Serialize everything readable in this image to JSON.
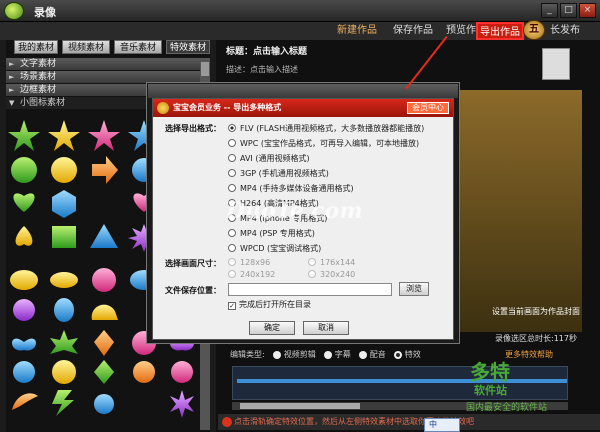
{
  "window": {
    "title": "录像"
  },
  "toolbar": {
    "new": "新建作品",
    "save": "保存作品",
    "preview": "预览作品",
    "export": "导出作品",
    "publish": "长发布",
    "publish_icon_text": "五"
  },
  "left": {
    "tabs": [
      "我的素材",
      "视频素材",
      "音乐素材",
      "特效素材"
    ],
    "active_tab": 3,
    "categories": [
      "文字素材",
      "场景素材",
      "边框素材",
      "小图标素材"
    ]
  },
  "right": {
    "title": "标题：点击输入标题",
    "desc": "描述：点击输入描述",
    "set_cover": "设置当前画面为作品封面",
    "duration": "录像选区总时长:117秒",
    "help": "更多特效帮助",
    "edit": {
      "label": "编辑类型:",
      "options": [
        "视频剪辑",
        "字幕",
        "配音",
        "特效"
      ],
      "selected": 3
    },
    "bottom_tip": "点击滑轨确定特效位置，然后从左侧特效素材中选取你喜欢的特效吧"
  },
  "dialog": {
    "title": "宝宝会员业务 -- 导出多种格式",
    "vip": "会员中心",
    "format_label": "选择导出格式：",
    "formats": [
      "FLV (FLASH通用视频格式，大多数播放器都能播放)",
      "WPC (宝宝作品格式，可再导入编辑，可本地播放)",
      "AVI (通用视频格式)",
      "3GP (手机通用视频格式)",
      "MP4 (手持多媒体设备通用格式)",
      "H264 (高清MP4格式)",
      "MP4 (iphone 专用格式)",
      "MP4 (PSP 专用格式)",
      "WPCD (宝宝调试格式)"
    ],
    "format_selected": 0,
    "size_label": "选择画面尺寸：",
    "sizes": [
      "128x96",
      "176x144",
      "240x192",
      "320x240"
    ],
    "path_label": "文件保存位置：",
    "path_value": "",
    "browse": "浏览",
    "open_after": "完成后打开所在目录",
    "open_after_checked": true,
    "ok": "确定",
    "cancel": "取消"
  },
  "watermark": {
    "duote": "DuoTe.com",
    "brand": "多特",
    "brand_small": "软件站",
    "slogan": "国内最安全的软件站"
  },
  "ime": "中"
}
